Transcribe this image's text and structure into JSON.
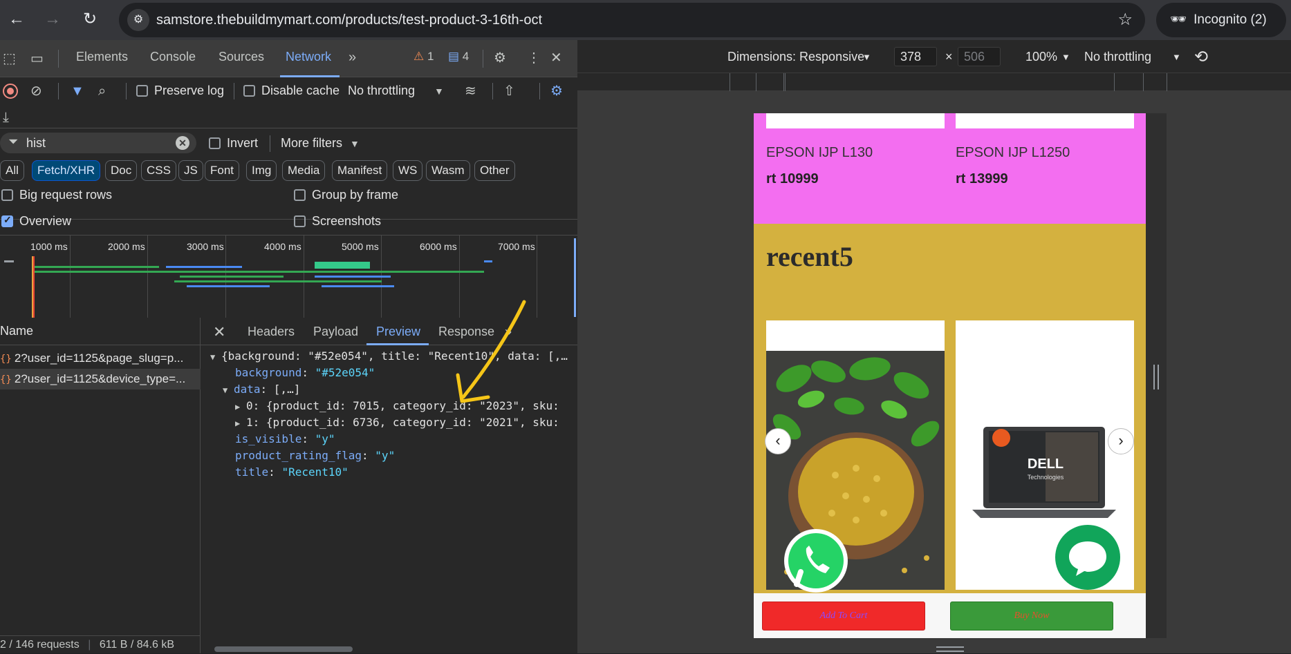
{
  "browser": {
    "url": "samstore.thebuildmymart.com/products/test-product-3-16th-oct",
    "incognito_label": "Incognito (2)"
  },
  "devtools": {
    "tabs": [
      "Elements",
      "Console",
      "Sources",
      "Network"
    ],
    "active_tab": "Network",
    "warnings_count": "1",
    "messages_count": "4",
    "toolbar": {
      "preserve_log": "Preserve log",
      "disable_cache": "Disable cache",
      "throttling": "No throttling"
    },
    "filter": {
      "value": "hist",
      "invert": "Invert",
      "more_filters": "More filters"
    },
    "type_filters": [
      "All",
      "Fetch/XHR",
      "Doc",
      "CSS",
      "JS",
      "Font",
      "Img",
      "Media",
      "Manifest",
      "WS",
      "Wasm",
      "Other"
    ],
    "active_type": "Fetch/XHR",
    "options": {
      "big_request_rows": "Big request rows",
      "group_by_frame": "Group by frame",
      "overview": "Overview",
      "screenshots": "Screenshots"
    },
    "overview_ticks": [
      "1000 ms",
      "2000 ms",
      "3000 ms",
      "4000 ms",
      "5000 ms",
      "6000 ms",
      "7000 ms"
    ],
    "name_header": "Name",
    "requests": [
      "2?user_id=1125&page_slug=p...",
      "2?user_id=1125&device_type=..."
    ],
    "status": {
      "requests": "2 / 146 requests",
      "size": "611 B / 84.6 kB"
    },
    "detail_tabs": [
      "Headers",
      "Payload",
      "Preview",
      "Response"
    ],
    "active_detail_tab": "Preview",
    "preview": {
      "root": "{background: \"#52e054\", title: \"Recent10\", data: [,…",
      "background_key": "background",
      "background_val": "\"#52e054\"",
      "data_key": "data",
      "data_val": "[,…]",
      "item0": "0: {product_id: 7015, category_id: \"2023\", sku:",
      "item1": "1: {product_id: 6736, category_id: \"2021\", sku:",
      "is_visible_key": "is_visible",
      "is_visible_val": "\"y\"",
      "rating_key": "product_rating_flag",
      "rating_val": "\"y\"",
      "title_key": "title",
      "title_val": "\"Recent10\""
    }
  },
  "device_toolbar": {
    "dimensions": "Dimensions: Responsive",
    "width": "378",
    "height": "506",
    "zoom": "100%",
    "throttling": "No throttling"
  },
  "page": {
    "products_top": [
      {
        "name": "EPSON IJP L130",
        "price": "rt 10999"
      },
      {
        "name": "EPSON IJP L1250",
        "price": "rt 13999"
      }
    ],
    "section_title": "recent5",
    "add_to_cart": "Add To Cart",
    "buy_now": "Buy Now",
    "dell_logo": "DELL",
    "dell_sub": "Technologies"
  },
  "colors": {
    "pink_section": "#f36ef0",
    "mustard_section": "#d4b13f",
    "add_cart": "#f02929",
    "buy_now": "#3a9a3a",
    "accent": "#7cacf8",
    "annotation_arrow": "#f5c518"
  }
}
